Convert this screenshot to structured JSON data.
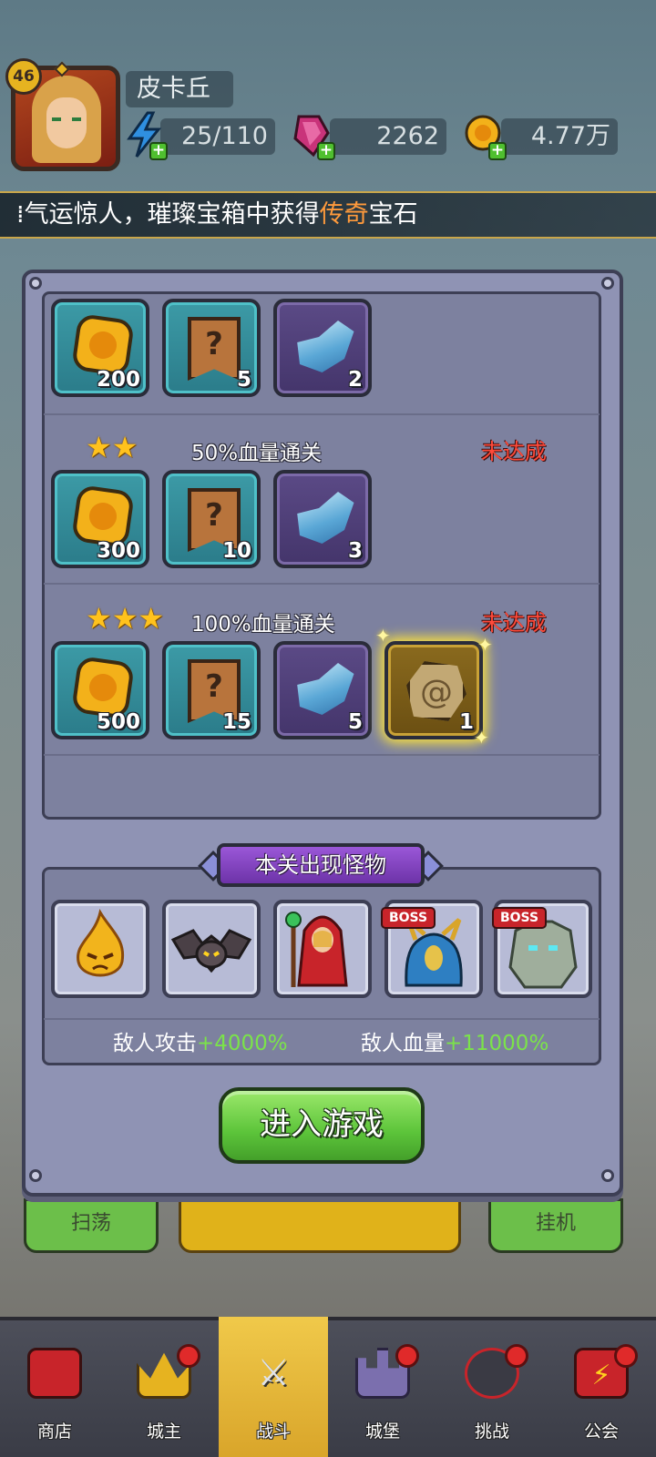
{
  "player": {
    "level": "46",
    "name": "皮卡丘"
  },
  "resources": {
    "energy": {
      "value": "25/110",
      "icon": "lightning-icon"
    },
    "gems": {
      "value": "2262",
      "icon": "gem-icon"
    },
    "gold": {
      "value": "4.77万",
      "icon": "coin-icon"
    }
  },
  "ticker": {
    "prefix": "气运惊人，璀璨宝箱中获得",
    "highlight": "传奇",
    "suffix": "宝石"
  },
  "rewards": {
    "row1": {
      "items": [
        {
          "type": "coin",
          "count": "200"
        },
        {
          "type": "scroll",
          "count": "5"
        },
        {
          "type": "crystal",
          "count": "2"
        }
      ]
    },
    "row2": {
      "stars": 2,
      "condition": "50%血量通关",
      "status": "未达成",
      "items": [
        {
          "type": "coin",
          "count": "300"
        },
        {
          "type": "scroll",
          "count": "10"
        },
        {
          "type": "crystal",
          "count": "3"
        }
      ]
    },
    "row3": {
      "stars": 3,
      "condition": "100%血量通关",
      "status": "未达成",
      "items": [
        {
          "type": "coin",
          "count": "500"
        },
        {
          "type": "scroll",
          "count": "15"
        },
        {
          "type": "crystal",
          "count": "5"
        },
        {
          "type": "rune",
          "count": "1"
        }
      ]
    }
  },
  "monsters": {
    "title": "本关出现怪物",
    "boss_label": "BOSS",
    "list": [
      {
        "name": "fire-spirit"
      },
      {
        "name": "bat"
      },
      {
        "name": "red-hood-mage"
      },
      {
        "name": "dragon",
        "boss": true
      },
      {
        "name": "stone-golem",
        "boss": true
      }
    ],
    "attack_label": "敌人攻击",
    "attack_value": "+4000%",
    "hp_label": "敌人血量",
    "hp_value": "+11000%"
  },
  "enter_button": "进入游戏",
  "under_buttons": {
    "sweep": "扫荡",
    "idle": "挂机"
  },
  "nav": [
    {
      "label": "商店",
      "icon": "shop-icon",
      "dot": false
    },
    {
      "label": "城主",
      "icon": "crown-icon",
      "dot": true
    },
    {
      "label": "战斗",
      "icon": "swords-icon",
      "dot": false,
      "active": true
    },
    {
      "label": "城堡",
      "icon": "castle-icon",
      "dot": true
    },
    {
      "label": "挑战",
      "icon": "challenge-icon",
      "dot": true
    },
    {
      "label": "公会",
      "icon": "guild-icon",
      "dot": true
    }
  ],
  "colors": {
    "status_red": "#ff4a3a",
    "stat_green": "#7be34a",
    "highlight_orange": "#ff9a3c",
    "button_green": "#5cc43a"
  }
}
